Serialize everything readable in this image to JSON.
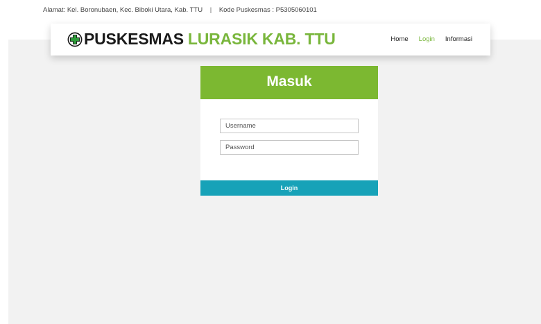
{
  "topbar": {
    "address": "Alamat: Kel. Boronubaen, Kec. Biboki Utara, Kab. TTU",
    "separator": "|",
    "code": "Kode Puskesmas : P5305060101"
  },
  "header": {
    "brand_primary": "PUSKESMAS",
    "brand_secondary": "LURASIK KAB. TTU",
    "logo_icon": "medical-cross-icon",
    "nav": {
      "home": "Home",
      "login": "Login",
      "info": "Informasi"
    }
  },
  "login": {
    "title": "Masuk",
    "username_placeholder": "Username",
    "username_value": "",
    "password_placeholder": "Password",
    "password_value": "",
    "submit_label": "Login"
  },
  "colors": {
    "accent_green": "#7cb831",
    "brand_green": "#79b63c",
    "button_teal": "#17a2b8",
    "background_gray": "#f2f2f2"
  }
}
